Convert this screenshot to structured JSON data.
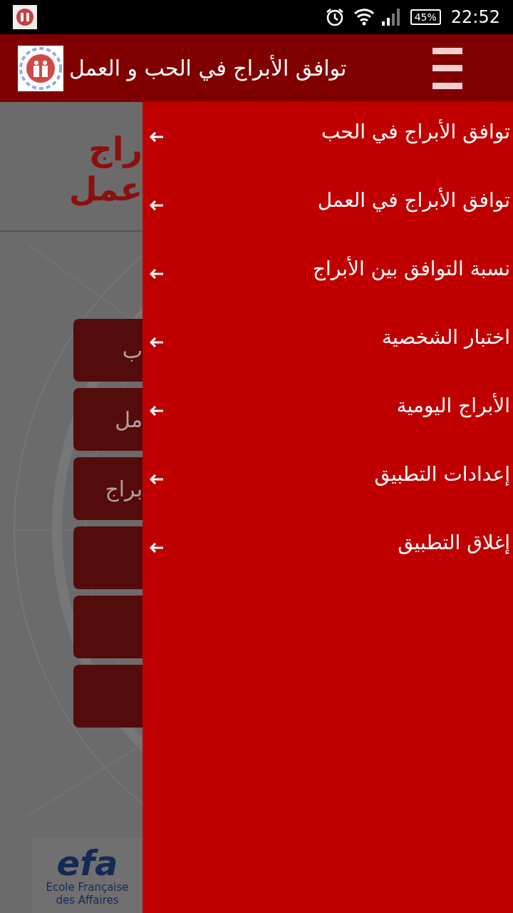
{
  "status_bar": {
    "battery": "45%",
    "time": "22:52"
  },
  "app_bar": {
    "title": "توافق الأبراج في الحب و العمل"
  },
  "background": {
    "heading_lines": [
      "راج",
      "عمل"
    ],
    "buttons": [
      {
        "kind": "labeled",
        "label": "ب"
      },
      {
        "kind": "labeled",
        "label": "مل"
      },
      {
        "kind": "labeled",
        "label": "براج"
      },
      {
        "kind": "blank"
      },
      {
        "kind": "blank"
      },
      {
        "kind": "blank"
      }
    ]
  },
  "ad": {
    "logo": "efa",
    "caption_lines": [
      "Ecole Française",
      "des Affaires"
    ]
  },
  "drawer": {
    "items": [
      {
        "label": "توافق الأبراج في الحب"
      },
      {
        "label": "توافق الأبراج في العمل"
      },
      {
        "label": "نسبة التوافق بين الأبراج"
      },
      {
        "label": "اختبار الشخصية"
      },
      {
        "label": "الأبراج اليومية"
      },
      {
        "label": "إعدادات التطبيق"
      },
      {
        "label": "إغلاق التطبيق"
      }
    ]
  }
}
